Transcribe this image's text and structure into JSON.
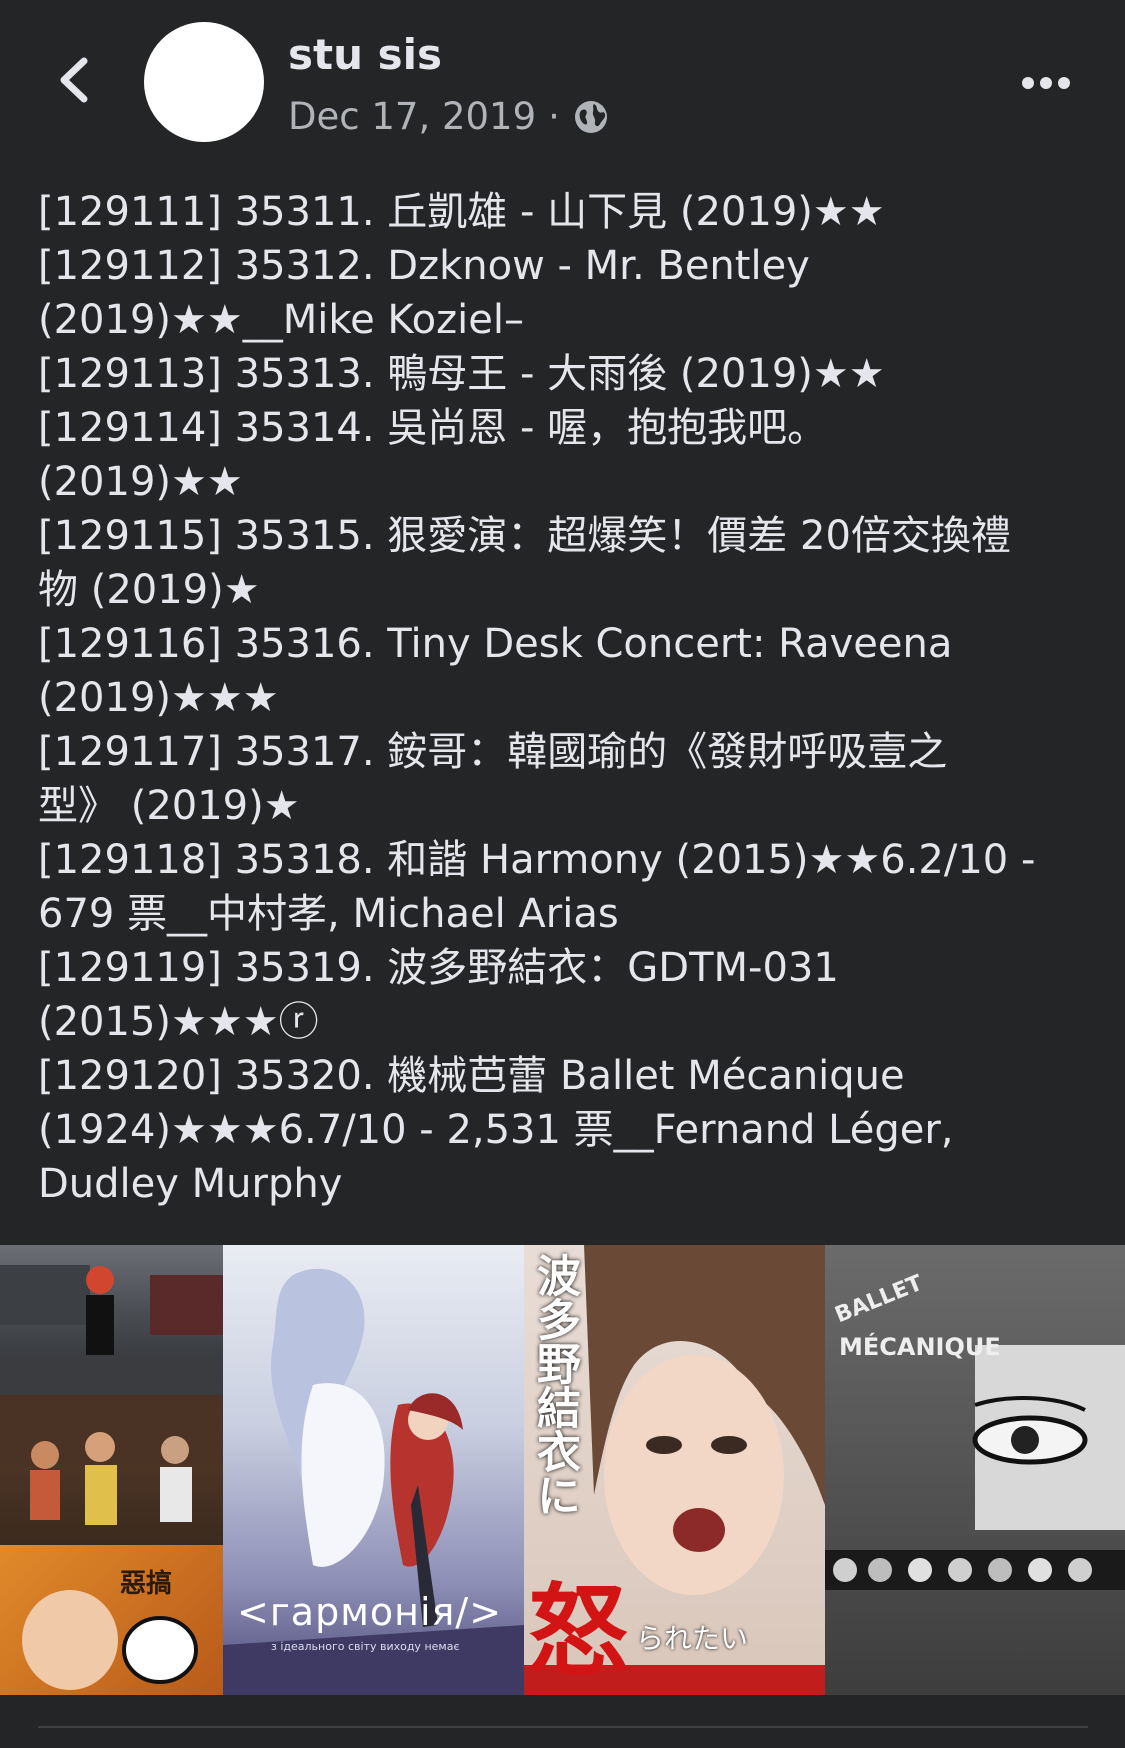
{
  "header": {
    "author": "stu sis",
    "date": "Dec 17, 2019",
    "separator": "·"
  },
  "icons": {
    "back": "chevron-left-icon",
    "privacy": "globe-icon",
    "more": "more-horizontal-icon"
  },
  "post": {
    "lines": [
      "[129111] 35311. 丘凱雄 - 山下見 (2019)★★",
      "[129112] 35312. Dzknow - Mr. Bentley",
      "(2019)★★__Mike Koziel–",
      "[129113] 35313. 鴨母王 - 大雨後 (2019)★★",
      "[129114] 35314. 吳尚恩 - 喔，抱抱我吧。",
      "(2019)★★",
      "[129115] 35315. 狠愛演：超爆笑！價差 20倍交換禮",
      "物 (2019)★",
      "[129116] 35316. Tiny Desk Concert: Raveena",
      "(2019)★★★",
      "[129117] 35317. 銨哥：韓國瑜的《發財呼吸壹之",
      "型》 (2019)★",
      "[129118] 35318. 和諧 Harmony (2015)★★6.2/10 -",
      "679 票__中村孝, Michael Arias",
      "[129119] 35319. 波多野結衣：GDTM-031",
      "(2015)★★★ⓡ",
      "[129120] 35320. 機械芭蕾 Ballet Mécanique",
      "(1924)★★★6.7/10 - 2,531 票__Fernand Léger,",
      "Dudley Murphy"
    ]
  },
  "photos": {
    "harmony_title": "<гармонія/>",
    "harmony_sub": "з ідеального світу виходу немає",
    "hatano_title": "波多野結衣に",
    "hatano_big": "怒",
    "hatano_sub": "られたい",
    "ballet_title_1": "BALLET",
    "ballet_title_2": "MÉCANIQUE",
    "comedy_title": "惡搞"
  },
  "colors": {
    "background": "#242526",
    "text": "#e4e6eb",
    "secondary": "#b0b3b8"
  }
}
